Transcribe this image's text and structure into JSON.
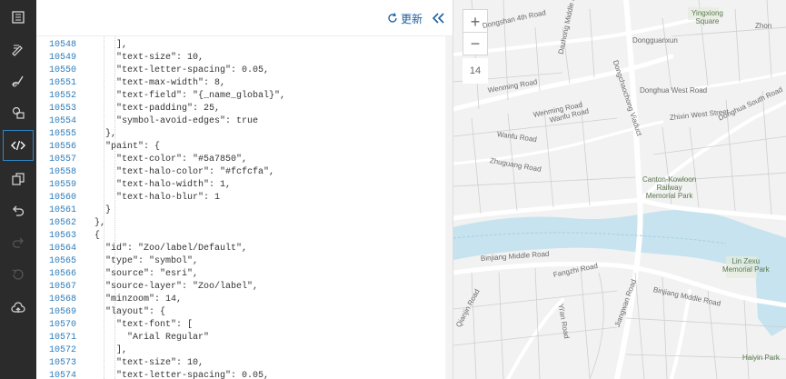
{
  "toolbar": {
    "tools": [
      {
        "icon": "layers-icon"
      },
      {
        "icon": "pen-icon"
      },
      {
        "icon": "brush-icon"
      },
      {
        "icon": "shapes-icon"
      },
      {
        "icon": "code-icon",
        "active": true
      },
      {
        "icon": "copy-icon"
      },
      {
        "icon": "undo-icon"
      },
      {
        "icon": "redo-icon"
      },
      {
        "icon": "history-icon"
      },
      {
        "icon": "cloud-upload-icon"
      }
    ]
  },
  "editor": {
    "refresh_label": "更新",
    "lines": [
      {
        "n": "10548",
        "indent": 3,
        "code": "],"
      },
      {
        "n": "10549",
        "indent": 3,
        "code": "\"text-size\": 10,"
      },
      {
        "n": "10550",
        "indent": 3,
        "code": "\"text-letter-spacing\": 0.05,"
      },
      {
        "n": "10551",
        "indent": 3,
        "code": "\"text-max-width\": 8,"
      },
      {
        "n": "10552",
        "indent": 3,
        "code": "\"text-field\": \"{_name_global}\","
      },
      {
        "n": "10553",
        "indent": 3,
        "code": "\"text-padding\": 25,"
      },
      {
        "n": "10554",
        "indent": 3,
        "code": "\"symbol-avoid-edges\": true"
      },
      {
        "n": "10555",
        "indent": 2,
        "code": "},"
      },
      {
        "n": "10556",
        "indent": 2,
        "code": "\"paint\": {"
      },
      {
        "n": "10557",
        "indent": 3,
        "code": "\"text-color\": \"#5a7850\","
      },
      {
        "n": "10558",
        "indent": 3,
        "code": "\"text-halo-color\": \"#fcfcfa\","
      },
      {
        "n": "10559",
        "indent": 3,
        "code": "\"text-halo-width\": 1,"
      },
      {
        "n": "10560",
        "indent": 3,
        "code": "\"text-halo-blur\": 1"
      },
      {
        "n": "10561",
        "indent": 2,
        "code": "}"
      },
      {
        "n": "10562",
        "indent": 1,
        "code": "},"
      },
      {
        "n": "10563",
        "indent": 1,
        "code": "{"
      },
      {
        "n": "10564",
        "indent": 2,
        "code": "\"id\": \"Zoo/label/Default\","
      },
      {
        "n": "10565",
        "indent": 2,
        "code": "\"type\": \"symbol\","
      },
      {
        "n": "10566",
        "indent": 2,
        "code": "\"source\": \"esri\","
      },
      {
        "n": "10567",
        "indent": 2,
        "code": "\"source-layer\": \"Zoo/label\","
      },
      {
        "n": "10568",
        "indent": 2,
        "code": "\"minzoom\": 14,"
      },
      {
        "n": "10569",
        "indent": 2,
        "code": "\"layout\": {"
      },
      {
        "n": "10570",
        "indent": 3,
        "code": "\"text-font\": ["
      },
      {
        "n": "10571",
        "indent": 4,
        "code": "\"Arial Regular\""
      },
      {
        "n": "10572",
        "indent": 3,
        "code": "],"
      },
      {
        "n": "10573",
        "indent": 3,
        "code": "\"text-size\": 10,"
      },
      {
        "n": "10574",
        "indent": 3,
        "code": "\"text-letter-spacing\": 0.05,"
      }
    ]
  },
  "map": {
    "zoom_in": "+",
    "zoom_out": "−",
    "zoom_level": "14",
    "water_color": "#c6e3ef",
    "road_color": "#ffffff",
    "land_color": "#f2f2f2",
    "labels": [
      {
        "text": "Yingxiong\nSquare",
        "type": "park"
      },
      {
        "text": "Dongguanxun",
        "type": "street"
      },
      {
        "text": "Donghua West Road",
        "type": "street"
      },
      {
        "text": "Wenming Road",
        "type": "street"
      },
      {
        "text": "Wenming Road",
        "type": "street"
      },
      {
        "text": "Wanfu Road",
        "type": "street"
      },
      {
        "text": "Wanfu Road",
        "type": "street"
      },
      {
        "text": "Zhuguang Road",
        "type": "street"
      },
      {
        "text": "Zhixin West Street",
        "type": "street"
      },
      {
        "text": "Donghua South Road",
        "type": "street"
      },
      {
        "text": "Dongshan 4th Road",
        "type": "street"
      },
      {
        "text": "Dazhong Middle Road",
        "type": "street"
      },
      {
        "text": "Dongchaochong Viaduct",
        "type": "street"
      },
      {
        "text": "Canton-Kowloon\nRailway\nMemorial Park",
        "type": "park"
      },
      {
        "text": "Binjiang Middle Road",
        "type": "street"
      },
      {
        "text": "Fangzhi Road",
        "type": "street"
      },
      {
        "text": "Binjiang Middle Road",
        "type": "street"
      },
      {
        "text": "Lin Zexu\nMemorial Park",
        "type": "park"
      },
      {
        "text": "Yi'an Road",
        "type": "street"
      },
      {
        "text": "Jiangwan Road",
        "type": "street"
      },
      {
        "text": "Haiyin Park",
        "type": "park"
      },
      {
        "text": "Zhon",
        "type": "street"
      },
      {
        "text": "Qianjin Road",
        "type": "street"
      }
    ]
  }
}
